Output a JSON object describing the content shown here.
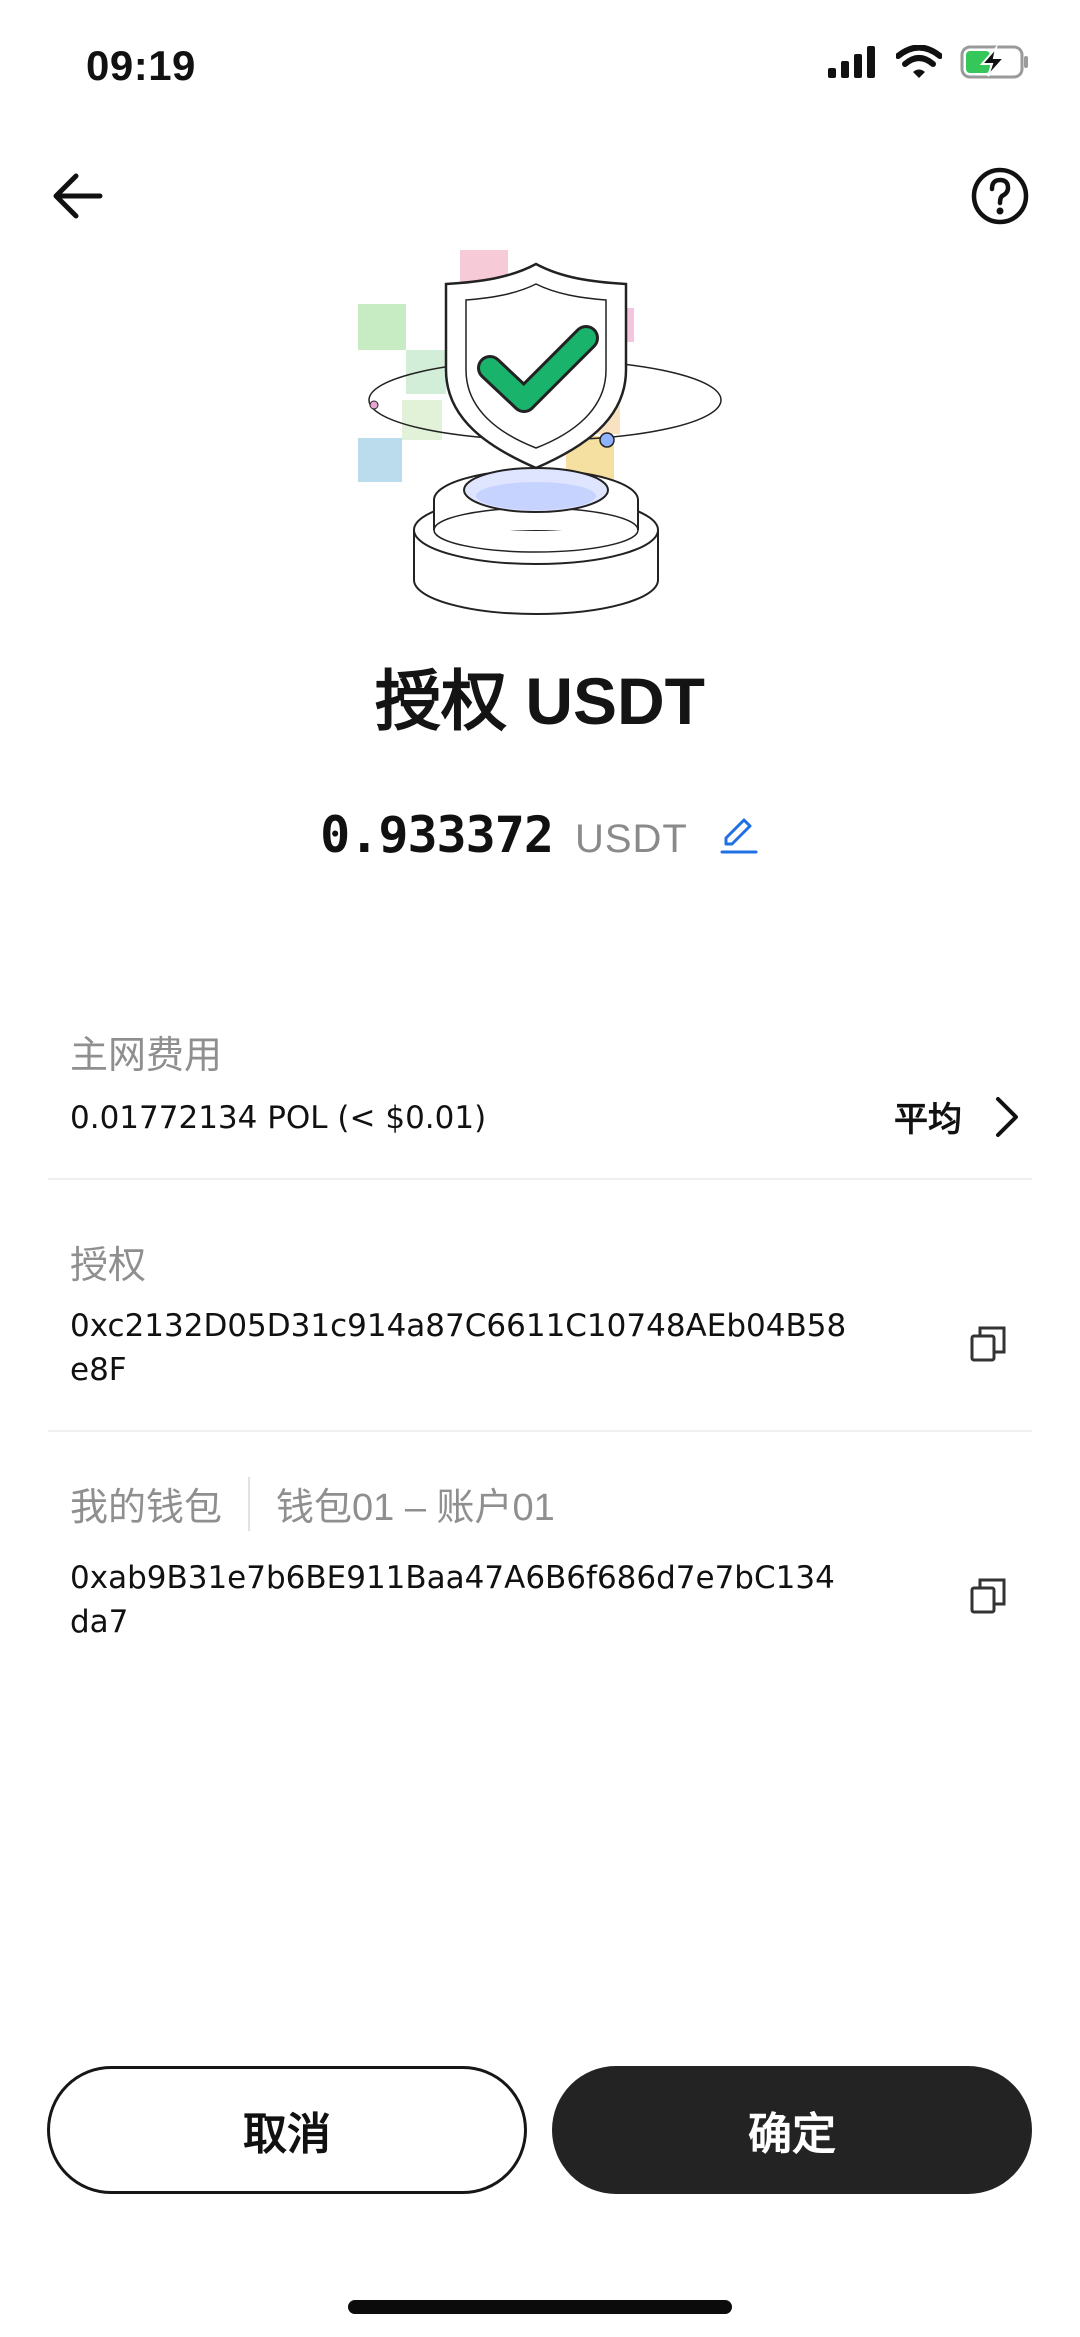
{
  "status_bar": {
    "time": "09:19"
  },
  "header": {
    "back_icon": "arrow-left-icon",
    "help_icon": "question-circle-icon"
  },
  "hero": {
    "illustration": "shield-check-illustration"
  },
  "title": "授权 USDT",
  "amount": {
    "value": "0.933372",
    "unit": "USDT",
    "edit_icon": "pencil-icon"
  },
  "network_fee": {
    "label": "主网费用",
    "value": "0.01772134 POL (< $0.01)",
    "speed": "平均"
  },
  "authorize": {
    "label": "授权",
    "address": "0xc2132D05D31c914a87C6611C10748AEb04B58e8F"
  },
  "wallet": {
    "label": "我的钱包",
    "account": "钱包01 – 账户01",
    "address": "0xab9B31e7b6BE911Baa47A6B6f686d7e7bC134da7"
  },
  "buttons": {
    "cancel": "取消",
    "confirm": "确定"
  },
  "colors": {
    "accent": "#1f6fe5",
    "check_green": "#19b36b",
    "button_dark": "#232323"
  }
}
